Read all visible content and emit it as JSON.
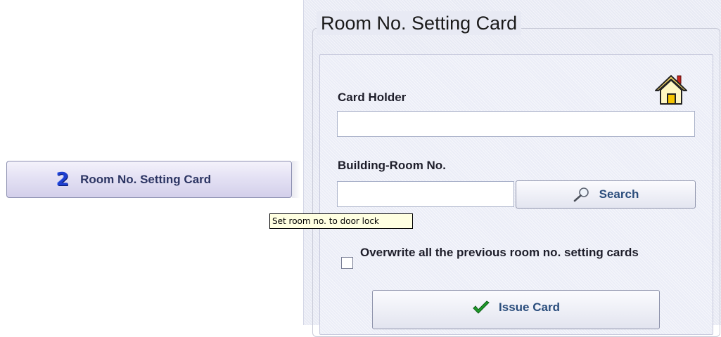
{
  "nav": {
    "step_number": "2",
    "button_label": "Room No. Setting Card"
  },
  "tooltip": {
    "text": "Set room no. to door lock"
  },
  "panel": {
    "title": "Room No. Setting Card",
    "card_holder_label": "Card Holder",
    "card_holder_value": "",
    "building_room_label": "Building-Room No.",
    "building_room_value": "",
    "search_label": "Search",
    "overwrite_label": "Overwrite all the previous room no. setting cards",
    "overwrite_checked": false,
    "issue_label": "Issue Card"
  },
  "icons": {
    "step": "step-2-icon",
    "home": "home-icon",
    "search": "magnifier-icon",
    "issue": "checkmark-icon"
  },
  "colors": {
    "accent_text": "#2a4d7c",
    "check_green": "#1e9b2a",
    "step_blue": "#1e3fcf"
  }
}
